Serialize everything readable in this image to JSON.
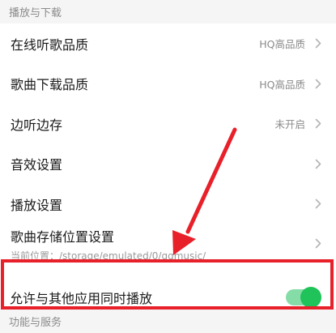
{
  "sections": {
    "playback_download": "播放与下载",
    "features_services": "功能与服务"
  },
  "rows": [
    {
      "title": "在线听歌品质",
      "value": "HQ高品质"
    },
    {
      "title": "歌曲下载品质",
      "value": "HQ高品质"
    },
    {
      "title": "边听边存",
      "value": "未开启"
    },
    {
      "title": "音效设置",
      "value": ""
    },
    {
      "title": "播放设置",
      "value": ""
    }
  ],
  "storage": {
    "title": "歌曲存储位置设置",
    "subtitle": "当前位置：/storage/emulated/0/qqmusic/"
  },
  "toggle_row": {
    "title": "允许与其他应用同时播放",
    "enabled": true
  },
  "colors": {
    "accent_green": "#20c25a",
    "highlight_red": "#e8202a"
  },
  "icons": {
    "chevron": "chevron-right-icon"
  }
}
